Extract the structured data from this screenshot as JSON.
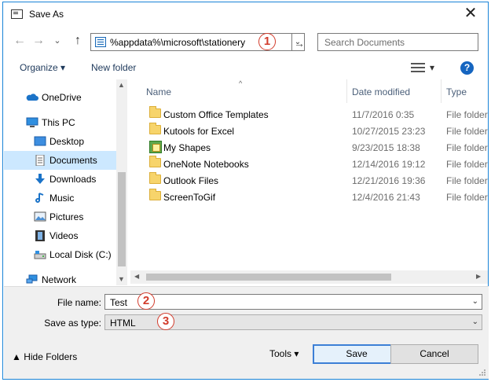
{
  "dialog": {
    "title": "Save As",
    "close_glyph": "✕"
  },
  "nav": {
    "back_glyph": "←",
    "forward_glyph": "→",
    "dropdown_glyph": "⌄",
    "up_glyph": "↑",
    "address": "%appdata%\\microsoft\\stationery",
    "go_glyph": "→",
    "search_placeholder": "Search Documents"
  },
  "annotations": {
    "badge1": "1",
    "badge2": "2",
    "badge3": "3"
  },
  "toolbar": {
    "organize": "Organize ▾",
    "new_folder": "New folder",
    "view_dd": "▾",
    "help": "?"
  },
  "sidebar": {
    "items": [
      {
        "label": "OneDrive",
        "icon": "cloud-icon"
      },
      {
        "label": "This PC",
        "icon": "computer-icon"
      },
      {
        "label": "Desktop",
        "icon": "desktop-icon"
      },
      {
        "label": "Documents",
        "icon": "document-icon",
        "selected": true
      },
      {
        "label": "Downloads",
        "icon": "download-icon"
      },
      {
        "label": "Music",
        "icon": "music-icon"
      },
      {
        "label": "Pictures",
        "icon": "pictures-icon"
      },
      {
        "label": "Videos",
        "icon": "videos-icon"
      },
      {
        "label": "Local Disk (C:)",
        "icon": "drive-icon"
      },
      {
        "label": "Network",
        "icon": "network-icon"
      }
    ],
    "scroll_up": "▲",
    "scroll_down": "▼"
  },
  "file_list": {
    "columns": [
      "Name",
      "Date modified",
      "Type"
    ],
    "sort_indicator": "^",
    "rows": [
      {
        "name": "Custom Office Templates",
        "date": "11/7/2016 0:35",
        "type": "File folder",
        "icon": "folder-icon"
      },
      {
        "name": "Kutools for Excel",
        "date": "10/27/2015 23:23",
        "type": "File folder",
        "icon": "folder-icon"
      },
      {
        "name": "My Shapes",
        "date": "9/23/2015 18:38",
        "type": "File folder",
        "icon": "shapes-folder-icon"
      },
      {
        "name": "OneNote Notebooks",
        "date": "12/14/2016 19:12",
        "type": "File folder",
        "icon": "folder-icon"
      },
      {
        "name": "Outlook Files",
        "date": "12/21/2016 19:36",
        "type": "File folder",
        "icon": "folder-icon"
      },
      {
        "name": "ScreenToGif",
        "date": "12/4/2016 21:43",
        "type": "File folder",
        "icon": "folder-icon"
      }
    ],
    "scroll_left": "◀",
    "scroll_right": "▶"
  },
  "form": {
    "file_name_label": "File name:",
    "file_name_value": "Test",
    "save_type_label": "Save as type:",
    "save_type_value": "HTML",
    "dropdown_glyph": "⌄"
  },
  "footer": {
    "hide_folders": "▲ Hide Folders",
    "tools": "Tools ▾",
    "save": "Save",
    "cancel": "Cancel"
  },
  "colors": {
    "accent": "#1883d7",
    "annotation": "#d23b2b",
    "selection": "#cce8ff"
  }
}
